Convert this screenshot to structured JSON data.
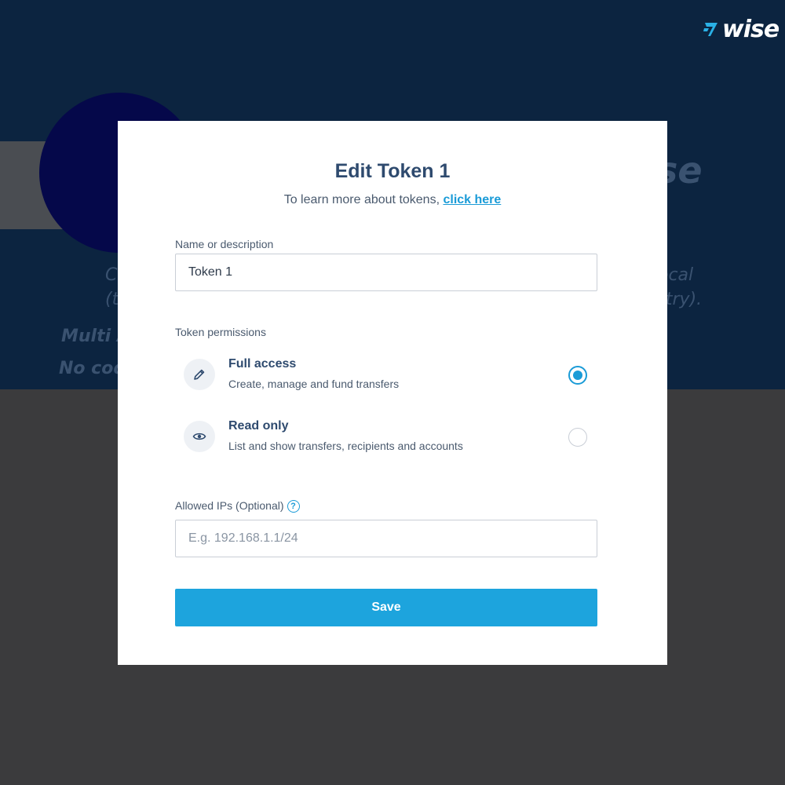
{
  "background": {
    "brand_fragment": "se",
    "lines": [
      "C",
      "(t",
      "Multi A",
      "No cod",
      "ocal",
      "untry)."
    ]
  },
  "logo": {
    "wordmark": "wise",
    "icon": "wise-flag-icon"
  },
  "modal": {
    "title": "Edit Token 1",
    "subtitle_prefix": "To learn more about tokens, ",
    "subtitle_link": "click here",
    "name_field": {
      "label": "Name or description",
      "value": "Token 1"
    },
    "permissions": {
      "label": "Token permissions",
      "options": [
        {
          "title": "Full access",
          "description": "Create, manage and fund transfers",
          "icon": "pencil-icon",
          "selected": true
        },
        {
          "title": "Read only",
          "description": "List and show transfers, recipients and accounts",
          "icon": "eye-icon",
          "selected": false
        }
      ]
    },
    "ips_field": {
      "label": "Allowed IPs (Optional)",
      "help_glyph": "?",
      "value": "",
      "placeholder": "E.g. 192.168.1.1/24"
    },
    "save_label": "Save"
  },
  "colors": {
    "accent": "#1da4dd",
    "heading": "#2e4a6e",
    "background_header": "#0c2440",
    "overlay": "#3b3b3d"
  }
}
